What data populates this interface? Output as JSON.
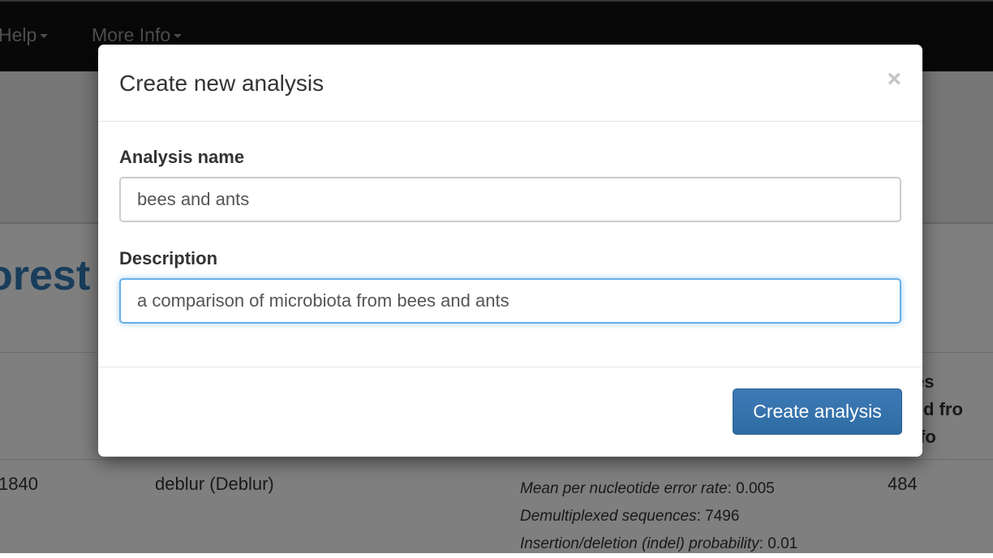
{
  "navbar": {
    "items": [
      {
        "label": "Help"
      },
      {
        "label": "More Info"
      }
    ]
  },
  "background": {
    "title_fragment": "orest a",
    "column_header_lines": [
      "nples",
      "ected fro",
      "o Info"
    ],
    "row": {
      "id": "1840",
      "method": "deblur (Deblur)",
      "params": [
        {
          "key": "Mean per nucleotide error rate",
          "value": ": 0.005"
        },
        {
          "key": "Demultiplexed sequences",
          "value": ": 7496"
        },
        {
          "key": "Insertion/deletion (indel) probability",
          "value": ": 0.01"
        }
      ],
      "samples": "484"
    }
  },
  "modal": {
    "title": "Create new analysis",
    "close_symbol": "×",
    "name_label": "Analysis name",
    "name_value": "bees and ants",
    "description_label": "Description",
    "description_value": "a comparison of microbiota from bees and ants",
    "submit_label": "Create analysis"
  }
}
